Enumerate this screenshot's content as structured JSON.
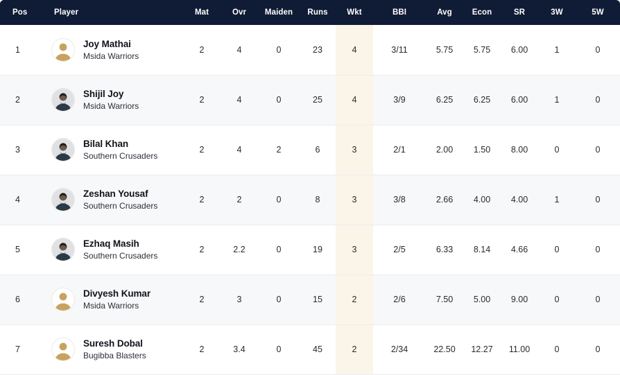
{
  "table": {
    "columns": [
      {
        "key": "pos",
        "label": "Pos"
      },
      {
        "key": "player",
        "label": "Player"
      },
      {
        "key": "mat",
        "label": "Mat"
      },
      {
        "key": "ovr",
        "label": "Ovr"
      },
      {
        "key": "maiden",
        "label": "Maiden"
      },
      {
        "key": "runs",
        "label": "Runs"
      },
      {
        "key": "wkt",
        "label": "Wkt"
      },
      {
        "key": "bbi",
        "label": "BBI"
      },
      {
        "key": "avg",
        "label": "Avg"
      },
      {
        "key": "econ",
        "label": "Econ"
      },
      {
        "key": "sr",
        "label": "SR"
      },
      {
        "key": "w3",
        "label": "3W"
      },
      {
        "key": "w5",
        "label": "5W"
      }
    ],
    "highlighted_column": "wkt",
    "colors": {
      "header_bg": "#101b35",
      "header_text": "#ffffff",
      "row_odd_bg": "#ffffff",
      "row_even_bg": "#f7f8f9",
      "highlight_bg": "#fbf5e9",
      "row_divider": "#ececee",
      "avatar_placeholder": "#c8a260"
    },
    "rows": [
      {
        "pos": "1",
        "name": "Joy Mathai",
        "team": "Msida Warriors",
        "avatar": "avatar-placeholder-icon",
        "mat": "2",
        "ovr": "4",
        "maiden": "0",
        "runs": "23",
        "wkt": "4",
        "bbi": "3/11",
        "avg": "5.75",
        "econ": "5.75",
        "sr": "6.00",
        "w3": "1",
        "w5": "0"
      },
      {
        "pos": "2",
        "name": "Shijil Joy",
        "team": "Msida Warriors",
        "avatar": "avatar-photo-icon",
        "mat": "2",
        "ovr": "4",
        "maiden": "0",
        "runs": "25",
        "wkt": "4",
        "bbi": "3/9",
        "avg": "6.25",
        "econ": "6.25",
        "sr": "6.00",
        "w3": "1",
        "w5": "0"
      },
      {
        "pos": "3",
        "name": "Bilal Khan",
        "team": "Southern Crusaders",
        "avatar": "avatar-photo-icon",
        "mat": "2",
        "ovr": "4",
        "maiden": "2",
        "runs": "6",
        "wkt": "3",
        "bbi": "2/1",
        "avg": "2.00",
        "econ": "1.50",
        "sr": "8.00",
        "w3": "0",
        "w5": "0"
      },
      {
        "pos": "4",
        "name": "Zeshan Yousaf",
        "team": "Southern Crusaders",
        "avatar": "avatar-photo-icon",
        "mat": "2",
        "ovr": "2",
        "maiden": "0",
        "runs": "8",
        "wkt": "3",
        "bbi": "3/8",
        "avg": "2.66",
        "econ": "4.00",
        "sr": "4.00",
        "w3": "1",
        "w5": "0"
      },
      {
        "pos": "5",
        "name": "Ezhaq Masih",
        "team": "Southern Crusaders",
        "avatar": "avatar-photo-icon",
        "mat": "2",
        "ovr": "2.2",
        "maiden": "0",
        "runs": "19",
        "wkt": "3",
        "bbi": "2/5",
        "avg": "6.33",
        "econ": "8.14",
        "sr": "4.66",
        "w3": "0",
        "w5": "0"
      },
      {
        "pos": "6",
        "name": "Divyesh Kumar",
        "team": "Msida Warriors",
        "avatar": "avatar-placeholder-icon",
        "mat": "2",
        "ovr": "3",
        "maiden": "0",
        "runs": "15",
        "wkt": "2",
        "bbi": "2/6",
        "avg": "7.50",
        "econ": "5.00",
        "sr": "9.00",
        "w3": "0",
        "w5": "0"
      },
      {
        "pos": "7",
        "name": "Suresh Dobal",
        "team": "Bugibba Blasters",
        "avatar": "avatar-placeholder-icon",
        "mat": "2",
        "ovr": "3.4",
        "maiden": "0",
        "runs": "45",
        "wkt": "2",
        "bbi": "2/34",
        "avg": "22.50",
        "econ": "12.27",
        "sr": "11.00",
        "w3": "0",
        "w5": "0"
      }
    ]
  }
}
